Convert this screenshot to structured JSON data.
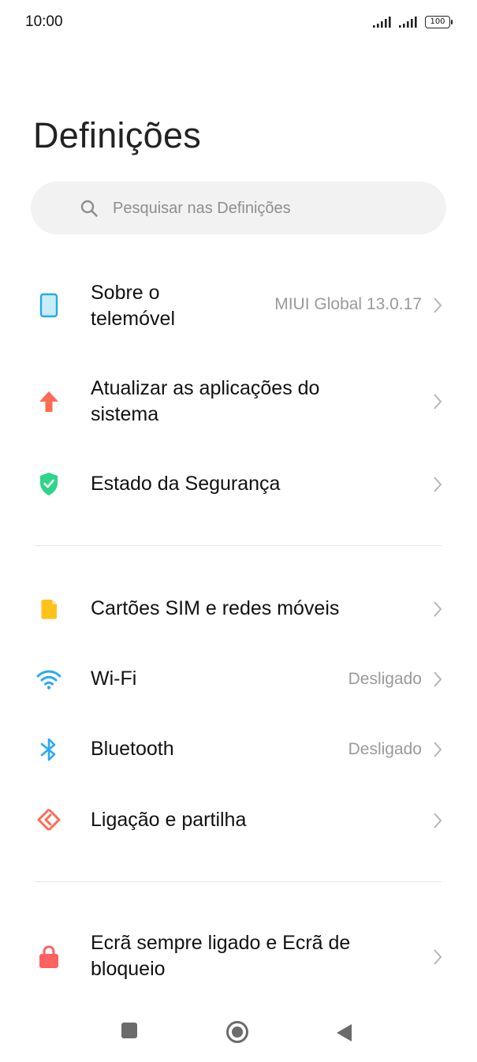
{
  "status_bar": {
    "time": "10:00",
    "battery": "100"
  },
  "title": "Definições",
  "search": {
    "placeholder": "Pesquisar nas Definições"
  },
  "settings": [
    {
      "label_lines": [
        "Sobre o",
        "telemóvel"
      ],
      "value": "MIUI Global 13.0.17",
      "icon": "phone-icon"
    },
    {
      "label_lines": [
        "Atualizar as aplicações do",
        "sistema"
      ],
      "value": "",
      "icon": "update-arrow-icon"
    },
    {
      "label_lines": [
        "Estado da Segurança"
      ],
      "value": "",
      "icon": "security-shield-icon"
    },
    {
      "label_lines": [
        "Cartões SIM e redes móveis"
      ],
      "value": "",
      "icon": "sim-card-icon"
    },
    {
      "label_lines": [
        "Wi-Fi"
      ],
      "value": "Desligado",
      "icon": "wifi-icon"
    },
    {
      "label_lines": [
        "Bluetooth"
      ],
      "value": "Desligado",
      "icon": "bluetooth-icon"
    },
    {
      "label_lines": [
        "Ligação e partilha"
      ],
      "value": "",
      "icon": "connection-sharing-icon"
    },
    {
      "label_lines": [
        "Ecrã sempre ligado e Ecrã de",
        "bloqueio"
      ],
      "value": "",
      "icon": "lock-icon"
    }
  ],
  "colors": {
    "phone": "#29a8e0",
    "update": "#ff6a55",
    "security": "#2ed48a",
    "sim": "#ffc21a",
    "wifi": "#2aa8f5",
    "bluetooth": "#2aa8f5",
    "sharing": "#ff6a55",
    "lock": "#ff6060"
  },
  "nav_bar": [
    "recents-button",
    "home-button",
    "back-button"
  ]
}
